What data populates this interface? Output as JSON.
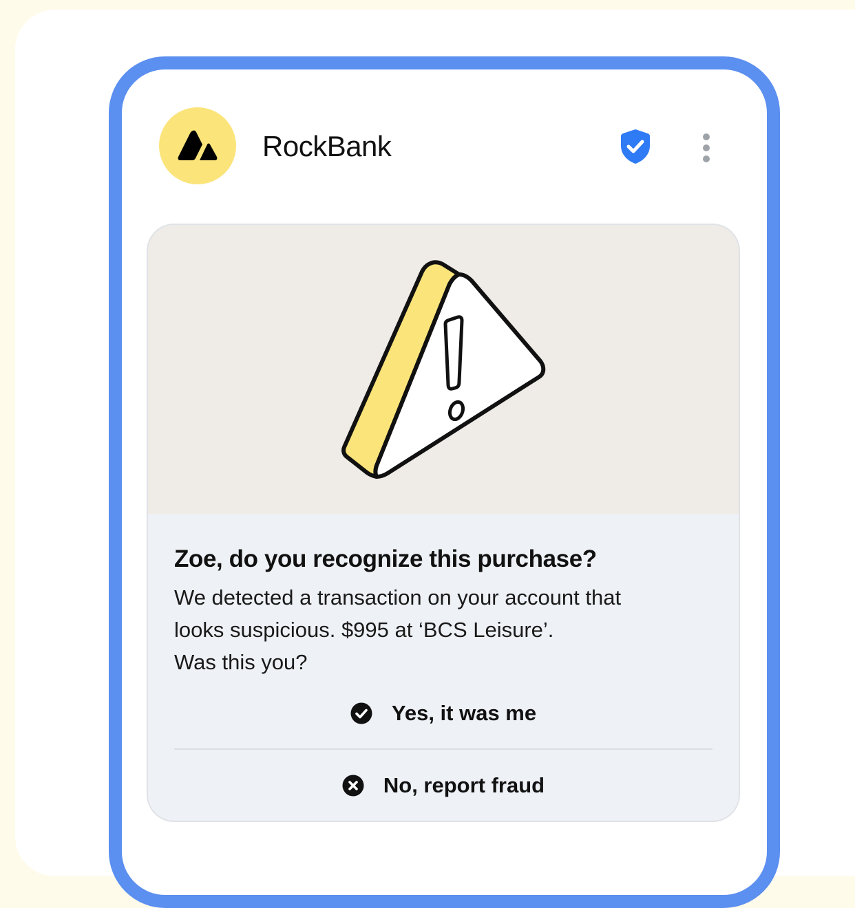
{
  "header": {
    "bank_name": "RockBank",
    "avatar_icon": "mountain-logo-icon",
    "verified_icon": "shield-check-icon",
    "menu_icon": "more-vertical-icon"
  },
  "alert": {
    "illustration": "warning-triangle-icon",
    "title": "Zoe, do you recognize this purchase?",
    "body_lines": [
      "We detected a transaction on your account that",
      "looks suspicious. $995 at ‘BCS Leisure’.",
      "Was this you?"
    ],
    "actions": {
      "confirm_label": "Yes, it was me",
      "confirm_icon": "check-circle-icon",
      "report_label": "No, report fraud",
      "report_icon": "x-circle-icon"
    }
  },
  "colors": {
    "phone_frame": "#5b8ff0",
    "avatar_bg": "#fbe47a",
    "verified_badge": "#2f7bf5",
    "illustration_bg": "#efebe7",
    "card_bg": "#eef1f5"
  }
}
